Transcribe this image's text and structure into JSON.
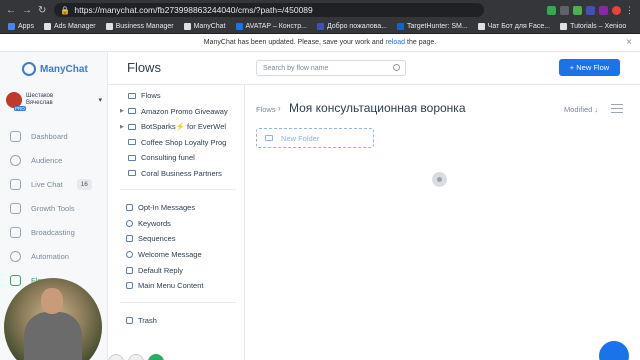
{
  "browser": {
    "url": "https://manychat.com/fb273998863244040/cms/?path=/450089",
    "bookmarks": [
      "Apps",
      "Ads Manager",
      "Business Manager",
      "ManyChat",
      "AVATAP – Констр...",
      "Добро пожалова...",
      "TargetHunter: SM...",
      "Чат Бот для Face...",
      "Tutorials – Xenioo"
    ]
  },
  "banner": {
    "text_before": "ManyChat has been updated. Please, save your work and",
    "link": "reload",
    "text_after": "the page.",
    "close": "×"
  },
  "app": {
    "logo": "ManyChat",
    "account_line1": "Шестаков",
    "account_line2": "Вячеслав",
    "pro_badge": "PRO",
    "nav": [
      {
        "label": "Dashboard"
      },
      {
        "label": "Audience"
      },
      {
        "label": "Live Chat",
        "count": "16"
      },
      {
        "label": "Growth Tools"
      },
      {
        "label": "Broadcasting"
      },
      {
        "label": "Automation"
      },
      {
        "label": "Flows"
      }
    ]
  },
  "flows": {
    "title": "Flows",
    "search_placeholder": "Search by flow name",
    "new_flow": "+ New Flow",
    "tree": [
      {
        "label": "Flows",
        "caret": ""
      },
      {
        "label": "Amazon Promo Giveaway",
        "caret": "▶"
      },
      {
        "label": "BotSparks⚡ for EverWel",
        "caret": "▶"
      },
      {
        "label": "Coffee Shop Loyalty Prog",
        "caret": ""
      },
      {
        "label": "Consulting funel",
        "caret": ""
      },
      {
        "label": "Coral Business Partners",
        "caret": ""
      }
    ],
    "system": [
      {
        "label": "Opt-In Messages"
      },
      {
        "label": "Keywords"
      },
      {
        "label": "Sequences"
      },
      {
        "label": "Welcome Message"
      },
      {
        "label": "Default Reply"
      },
      {
        "label": "Main Menu Content"
      }
    ],
    "trash": "Trash"
  },
  "main": {
    "breadcrumb_root": "Flows",
    "breadcrumb_sep": "›",
    "current_folder": "Моя консультационная воронка",
    "sort": "Modified ↓",
    "new_folder": "New Folder"
  },
  "colors": {
    "accent": "#1a73e8",
    "active_nav": "#27ae60"
  }
}
